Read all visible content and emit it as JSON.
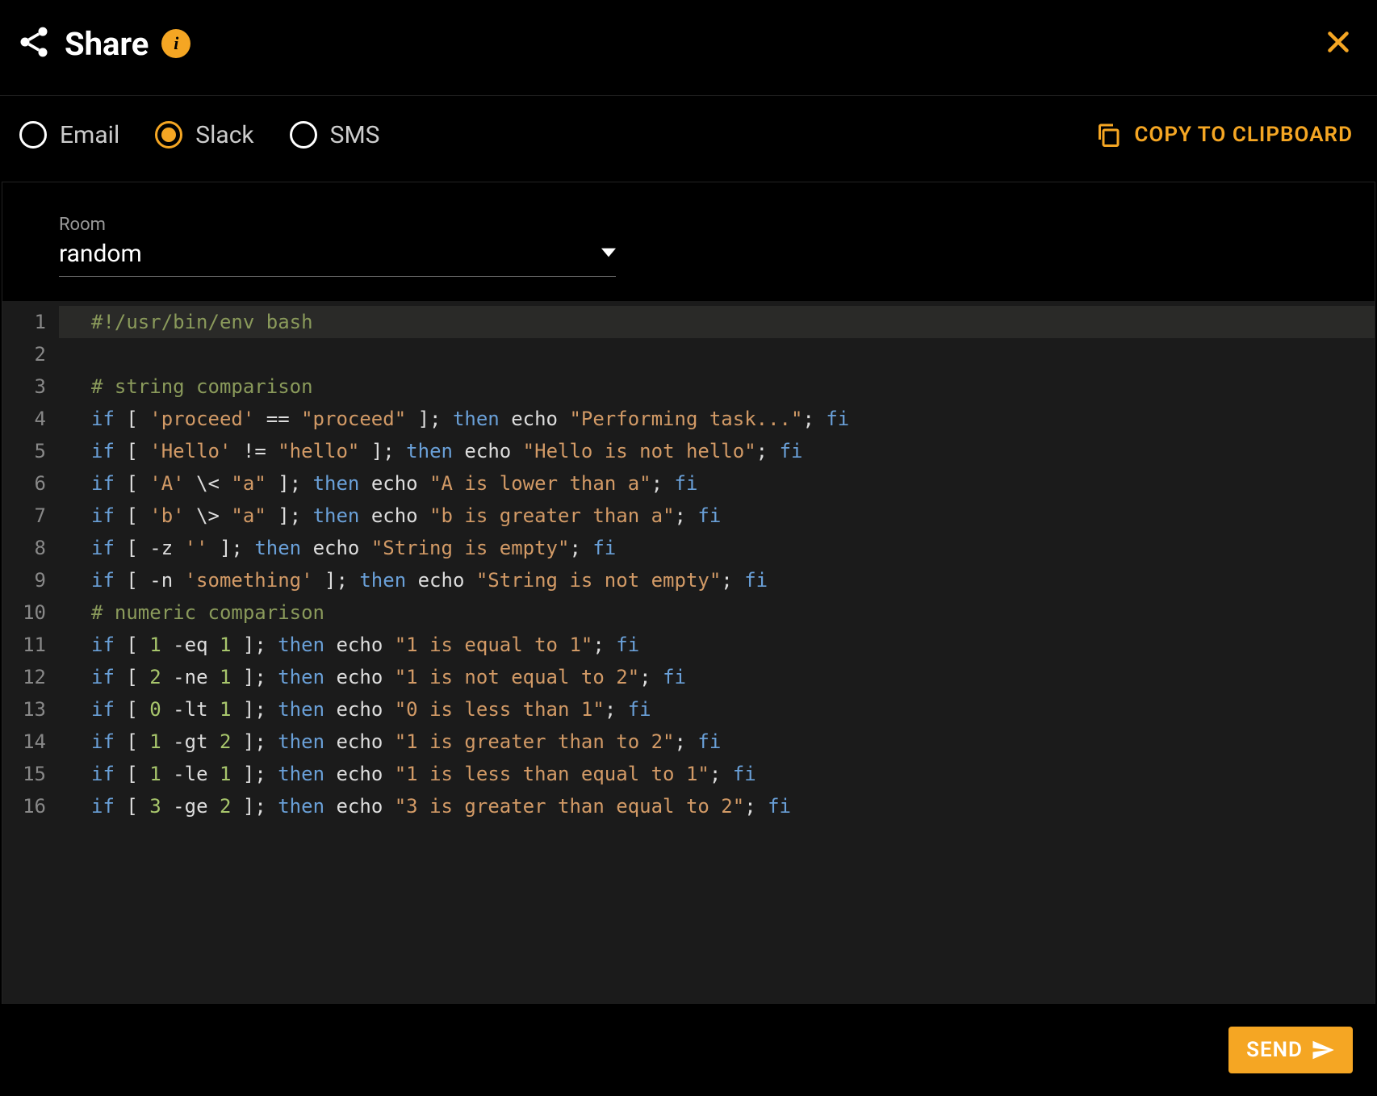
{
  "header": {
    "title": "Share",
    "info_tooltip": "i"
  },
  "share_options": {
    "items": [
      {
        "id": "email",
        "label": "Email",
        "selected": false
      },
      {
        "id": "slack",
        "label": "Slack",
        "selected": true
      },
      {
        "id": "sms",
        "label": "SMS",
        "selected": false
      }
    ],
    "copy_label": "COPY TO CLIPBOARD"
  },
  "room": {
    "label": "Room",
    "value": "random"
  },
  "code": {
    "lines": [
      {
        "n": 1,
        "tokens": [
          {
            "t": "#!/usr/bin/env bash",
            "c": "comment"
          }
        ],
        "current": true
      },
      {
        "n": 2,
        "tokens": []
      },
      {
        "n": 3,
        "tokens": [
          {
            "t": "# string comparison",
            "c": "comment"
          }
        ]
      },
      {
        "n": 4,
        "tokens": [
          {
            "t": "if",
            "c": "kw"
          },
          {
            "t": " [ ",
            "c": "punc"
          },
          {
            "t": "'proceed'",
            "c": "str"
          },
          {
            "t": " == ",
            "c": "punc"
          },
          {
            "t": "\"proceed\"",
            "c": "str"
          },
          {
            "t": " ]; ",
            "c": "punc"
          },
          {
            "t": "then",
            "c": "kw"
          },
          {
            "t": " ",
            "c": "punc"
          },
          {
            "t": "echo",
            "c": "cmd"
          },
          {
            "t": " ",
            "c": "punc"
          },
          {
            "t": "\"Performing task...\"",
            "c": "str"
          },
          {
            "t": "; ",
            "c": "punc"
          },
          {
            "t": "fi",
            "c": "kw"
          }
        ]
      },
      {
        "n": 5,
        "tokens": [
          {
            "t": "if",
            "c": "kw"
          },
          {
            "t": " [ ",
            "c": "punc"
          },
          {
            "t": "'Hello'",
            "c": "str"
          },
          {
            "t": " != ",
            "c": "punc"
          },
          {
            "t": "\"hello\"",
            "c": "str"
          },
          {
            "t": " ]; ",
            "c": "punc"
          },
          {
            "t": "then",
            "c": "kw"
          },
          {
            "t": " ",
            "c": "punc"
          },
          {
            "t": "echo",
            "c": "cmd"
          },
          {
            "t": " ",
            "c": "punc"
          },
          {
            "t": "\"Hello is not hello\"",
            "c": "str"
          },
          {
            "t": "; ",
            "c": "punc"
          },
          {
            "t": "fi",
            "c": "kw"
          }
        ]
      },
      {
        "n": 6,
        "tokens": [
          {
            "t": "if",
            "c": "kw"
          },
          {
            "t": " [ ",
            "c": "punc"
          },
          {
            "t": "'A'",
            "c": "str"
          },
          {
            "t": " \\< ",
            "c": "punc"
          },
          {
            "t": "\"a\"",
            "c": "str"
          },
          {
            "t": " ]; ",
            "c": "punc"
          },
          {
            "t": "then",
            "c": "kw"
          },
          {
            "t": " ",
            "c": "punc"
          },
          {
            "t": "echo",
            "c": "cmd"
          },
          {
            "t": " ",
            "c": "punc"
          },
          {
            "t": "\"A is lower than a\"",
            "c": "str"
          },
          {
            "t": "; ",
            "c": "punc"
          },
          {
            "t": "fi",
            "c": "kw"
          }
        ]
      },
      {
        "n": 7,
        "tokens": [
          {
            "t": "if",
            "c": "kw"
          },
          {
            "t": " [ ",
            "c": "punc"
          },
          {
            "t": "'b'",
            "c": "str"
          },
          {
            "t": " \\> ",
            "c": "punc"
          },
          {
            "t": "\"a\"",
            "c": "str"
          },
          {
            "t": " ]; ",
            "c": "punc"
          },
          {
            "t": "then",
            "c": "kw"
          },
          {
            "t": " ",
            "c": "punc"
          },
          {
            "t": "echo",
            "c": "cmd"
          },
          {
            "t": " ",
            "c": "punc"
          },
          {
            "t": "\"b is greater than a\"",
            "c": "str"
          },
          {
            "t": "; ",
            "c": "punc"
          },
          {
            "t": "fi",
            "c": "kw"
          }
        ]
      },
      {
        "n": 8,
        "tokens": [
          {
            "t": "if",
            "c": "kw"
          },
          {
            "t": " [ -z ",
            "c": "punc"
          },
          {
            "t": "''",
            "c": "str"
          },
          {
            "t": " ]; ",
            "c": "punc"
          },
          {
            "t": "then",
            "c": "kw"
          },
          {
            "t": " ",
            "c": "punc"
          },
          {
            "t": "echo",
            "c": "cmd"
          },
          {
            "t": " ",
            "c": "punc"
          },
          {
            "t": "\"String is empty\"",
            "c": "str"
          },
          {
            "t": "; ",
            "c": "punc"
          },
          {
            "t": "fi",
            "c": "kw"
          }
        ]
      },
      {
        "n": 9,
        "tokens": [
          {
            "t": "if",
            "c": "kw"
          },
          {
            "t": " [ -n ",
            "c": "punc"
          },
          {
            "t": "'something'",
            "c": "str"
          },
          {
            "t": " ]; ",
            "c": "punc"
          },
          {
            "t": "then",
            "c": "kw"
          },
          {
            "t": " ",
            "c": "punc"
          },
          {
            "t": "echo",
            "c": "cmd"
          },
          {
            "t": " ",
            "c": "punc"
          },
          {
            "t": "\"String is not empty\"",
            "c": "str"
          },
          {
            "t": "; ",
            "c": "punc"
          },
          {
            "t": "fi",
            "c": "kw"
          }
        ]
      },
      {
        "n": 10,
        "tokens": [
          {
            "t": "# numeric comparison",
            "c": "comment"
          }
        ]
      },
      {
        "n": 11,
        "tokens": [
          {
            "t": "if",
            "c": "kw"
          },
          {
            "t": " [ ",
            "c": "punc"
          },
          {
            "t": "1",
            "c": "num"
          },
          {
            "t": " -eq ",
            "c": "punc"
          },
          {
            "t": "1",
            "c": "num"
          },
          {
            "t": " ]; ",
            "c": "punc"
          },
          {
            "t": "then",
            "c": "kw"
          },
          {
            "t": " ",
            "c": "punc"
          },
          {
            "t": "echo",
            "c": "cmd"
          },
          {
            "t": " ",
            "c": "punc"
          },
          {
            "t": "\"1 is equal to 1\"",
            "c": "str"
          },
          {
            "t": "; ",
            "c": "punc"
          },
          {
            "t": "fi",
            "c": "kw"
          }
        ]
      },
      {
        "n": 12,
        "tokens": [
          {
            "t": "if",
            "c": "kw"
          },
          {
            "t": " [ ",
            "c": "punc"
          },
          {
            "t": "2",
            "c": "num"
          },
          {
            "t": " -ne ",
            "c": "punc"
          },
          {
            "t": "1",
            "c": "num"
          },
          {
            "t": " ]; ",
            "c": "punc"
          },
          {
            "t": "then",
            "c": "kw"
          },
          {
            "t": " ",
            "c": "punc"
          },
          {
            "t": "echo",
            "c": "cmd"
          },
          {
            "t": " ",
            "c": "punc"
          },
          {
            "t": "\"1 is not equal to 2\"",
            "c": "str"
          },
          {
            "t": "; ",
            "c": "punc"
          },
          {
            "t": "fi",
            "c": "kw"
          }
        ]
      },
      {
        "n": 13,
        "tokens": [
          {
            "t": "if",
            "c": "kw"
          },
          {
            "t": " [ ",
            "c": "punc"
          },
          {
            "t": "0",
            "c": "num"
          },
          {
            "t": " -lt ",
            "c": "punc"
          },
          {
            "t": "1",
            "c": "num"
          },
          {
            "t": " ]; ",
            "c": "punc"
          },
          {
            "t": "then",
            "c": "kw"
          },
          {
            "t": " ",
            "c": "punc"
          },
          {
            "t": "echo",
            "c": "cmd"
          },
          {
            "t": " ",
            "c": "punc"
          },
          {
            "t": "\"0 is less than 1\"",
            "c": "str"
          },
          {
            "t": "; ",
            "c": "punc"
          },
          {
            "t": "fi",
            "c": "kw"
          }
        ]
      },
      {
        "n": 14,
        "tokens": [
          {
            "t": "if",
            "c": "kw"
          },
          {
            "t": " [ ",
            "c": "punc"
          },
          {
            "t": "1",
            "c": "num"
          },
          {
            "t": " -gt ",
            "c": "punc"
          },
          {
            "t": "2",
            "c": "num"
          },
          {
            "t": " ]; ",
            "c": "punc"
          },
          {
            "t": "then",
            "c": "kw"
          },
          {
            "t": " ",
            "c": "punc"
          },
          {
            "t": "echo",
            "c": "cmd"
          },
          {
            "t": " ",
            "c": "punc"
          },
          {
            "t": "\"1 is greater than to 2\"",
            "c": "str"
          },
          {
            "t": "; ",
            "c": "punc"
          },
          {
            "t": "fi",
            "c": "kw"
          }
        ]
      },
      {
        "n": 15,
        "tokens": [
          {
            "t": "if",
            "c": "kw"
          },
          {
            "t": " [ ",
            "c": "punc"
          },
          {
            "t": "1",
            "c": "num"
          },
          {
            "t": " -le ",
            "c": "punc"
          },
          {
            "t": "1",
            "c": "num"
          },
          {
            "t": " ]; ",
            "c": "punc"
          },
          {
            "t": "then",
            "c": "kw"
          },
          {
            "t": " ",
            "c": "punc"
          },
          {
            "t": "echo",
            "c": "cmd"
          },
          {
            "t": " ",
            "c": "punc"
          },
          {
            "t": "\"1 is less than equal to 1\"",
            "c": "str"
          },
          {
            "t": "; ",
            "c": "punc"
          },
          {
            "t": "fi",
            "c": "kw"
          }
        ]
      },
      {
        "n": 16,
        "tokens": [
          {
            "t": "if",
            "c": "kw"
          },
          {
            "t": " [ ",
            "c": "punc"
          },
          {
            "t": "3",
            "c": "num"
          },
          {
            "t": " -ge ",
            "c": "punc"
          },
          {
            "t": "2",
            "c": "num"
          },
          {
            "t": " ]; ",
            "c": "punc"
          },
          {
            "t": "then",
            "c": "kw"
          },
          {
            "t": " ",
            "c": "punc"
          },
          {
            "t": "echo",
            "c": "cmd"
          },
          {
            "t": " ",
            "c": "punc"
          },
          {
            "t": "\"3 is greater than equal to 2\"",
            "c": "str"
          },
          {
            "t": "; ",
            "c": "punc"
          },
          {
            "t": "fi",
            "c": "kw"
          }
        ]
      }
    ]
  },
  "footer": {
    "send_label": "SEND"
  },
  "colors": {
    "accent": "#f5a623"
  }
}
